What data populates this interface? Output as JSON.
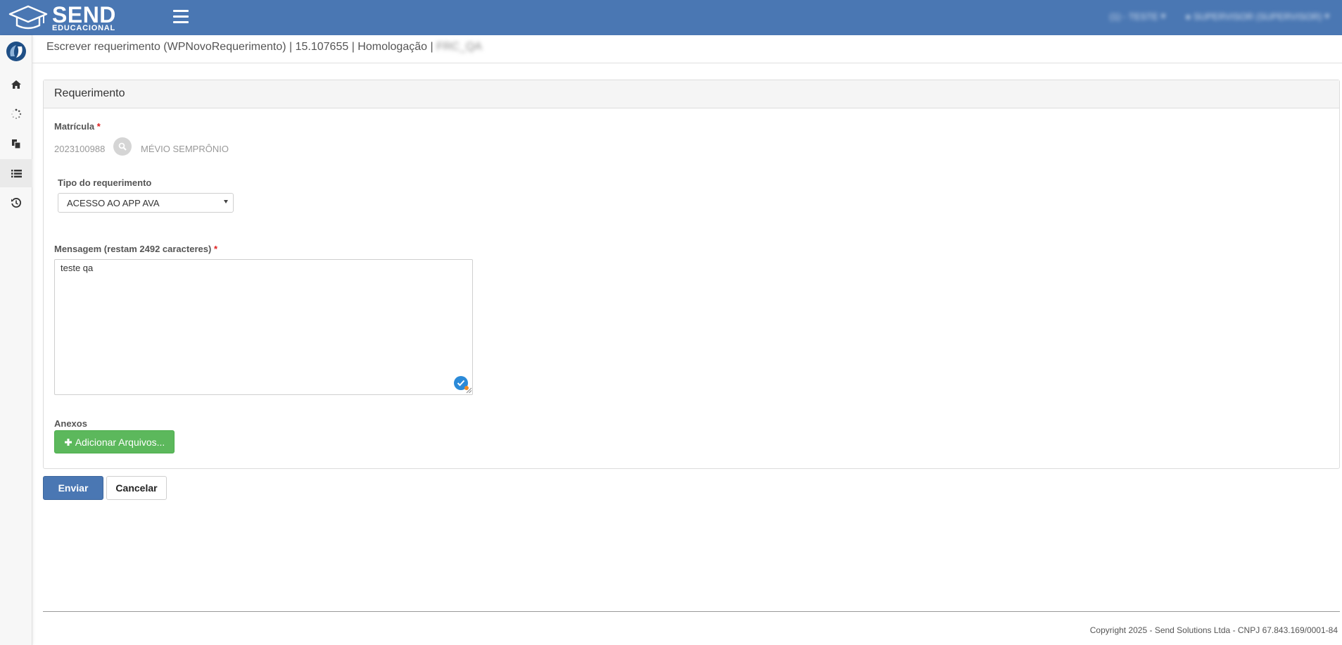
{
  "header": {
    "logo_name": "SEND",
    "logo_subtitle": "EDUCACIONAL",
    "menu_icon": "hamburger-icon",
    "user_menu_1": "(1) - TESTE",
    "user_menu_2": "SUPERVISOR (SUPERVISOR)"
  },
  "sidebar": {
    "items": [
      {
        "icon": "home-icon"
      },
      {
        "icon": "spinner-icon"
      },
      {
        "icon": "copy-icon"
      },
      {
        "icon": "list-icon"
      },
      {
        "icon": "history-icon"
      }
    ]
  },
  "breadcrumb": {
    "text": "Escrever requerimento (WPNovoRequerimento) | 15.107655 | Homologação |",
    "blurred": "FRC_QA"
  },
  "panel": {
    "title": "Requerimento",
    "matricula_label": "Matrícula",
    "required_mark": "*",
    "matricula_value": "2023100988",
    "student_name": "MÉVIO SEMPRÔNIO",
    "tipo_label": "Tipo do requerimento",
    "tipo_selected": "ACESSO AO APP AVA",
    "mensagem_label": "Mensagem (restam 2492 caracteres)",
    "mensagem_value": "teste qa",
    "anexos_label": "Anexos",
    "add_files_label": "Adicionar Arquivos..."
  },
  "actions": {
    "send_label": "Enviar",
    "cancel_label": "Cancelar"
  },
  "footer": {
    "copyright": "Copyright 2025 - Send Solutions Ltda - CNPJ 67.843.169/0001-84"
  },
  "colors": {
    "primary": "#4a77b3",
    "success": "#5cb85c",
    "required": "#e02020"
  }
}
